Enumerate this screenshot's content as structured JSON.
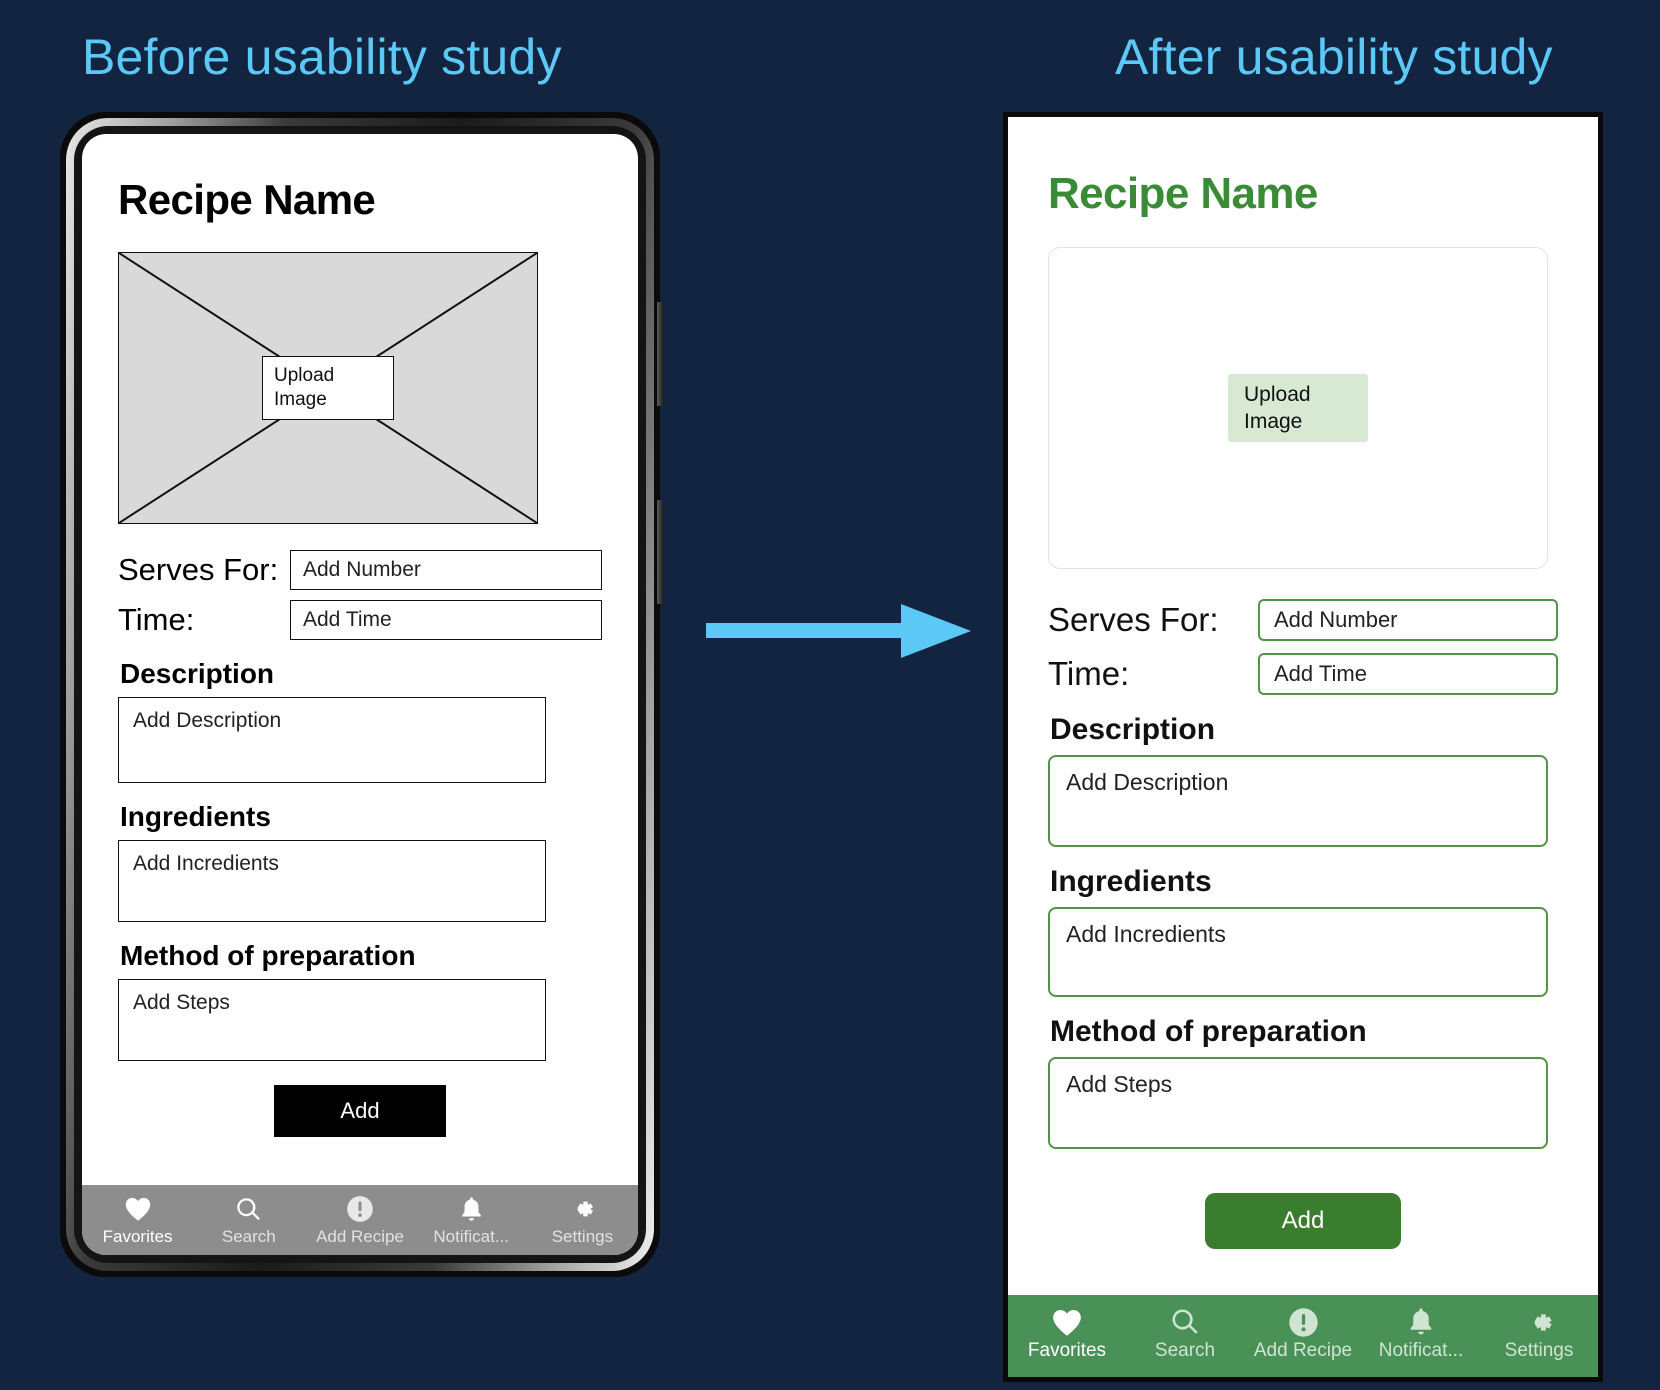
{
  "headings": {
    "before": "Before usability study",
    "after": "After usability study"
  },
  "colors": {
    "background": "#12243f",
    "heading_blue": "#5bc8f5",
    "arrow_blue": "#5bc8f5",
    "brand_green": "#3a8a36",
    "nav_green": "#4a9158",
    "button_green": "#3b7d2e",
    "upload_green": "#d7e8d3",
    "wireframe_gray": "#d9d9d9",
    "wireframe_nav_gray": "#8d8d8d"
  },
  "before": {
    "recipe_title": "Recipe Name",
    "upload": {
      "line1": "Upload",
      "line2": "Image"
    },
    "fields": [
      {
        "label": "Serves For:",
        "value": "Add Number"
      },
      {
        "label": "Time:",
        "value": "Add Time"
      }
    ],
    "sections": [
      {
        "title": "Description",
        "value": "Add Description"
      },
      {
        "title": "Ingredients",
        "value": "Add Incredients"
      },
      {
        "title": "Method of preparation",
        "value": "Add Steps"
      }
    ],
    "add_button": "Add",
    "nav": [
      {
        "icon": "heart-icon",
        "label": "Favorites"
      },
      {
        "icon": "search-icon",
        "label": "Search"
      },
      {
        "icon": "exclamation-circle-icon",
        "label": "Add Recipe"
      },
      {
        "icon": "bell-icon",
        "label": "Notificat..."
      },
      {
        "icon": "gear-icon",
        "label": "Settings"
      }
    ]
  },
  "after": {
    "recipe_title": "Recipe Name",
    "upload": {
      "line1": "Upload",
      "line2": "Image"
    },
    "fields": [
      {
        "label": "Serves For:",
        "value": "Add Number"
      },
      {
        "label": "Time:",
        "value": "Add Time"
      }
    ],
    "sections": [
      {
        "title": "Description",
        "value": "Add Description"
      },
      {
        "title": "Ingredients",
        "value": "Add Incredients"
      },
      {
        "title": "Method of preparation",
        "value": "Add Steps"
      }
    ],
    "add_button": "Add",
    "nav": [
      {
        "icon": "heart-icon",
        "label": "Favorites",
        "active": true
      },
      {
        "icon": "search-icon",
        "label": "Search",
        "active": false
      },
      {
        "icon": "exclamation-circle-icon",
        "label": "Add Recipe",
        "active": false
      },
      {
        "icon": "bell-icon",
        "label": "Notificat...",
        "active": false
      },
      {
        "icon": "gear-icon",
        "label": "Settings",
        "active": false
      }
    ]
  }
}
